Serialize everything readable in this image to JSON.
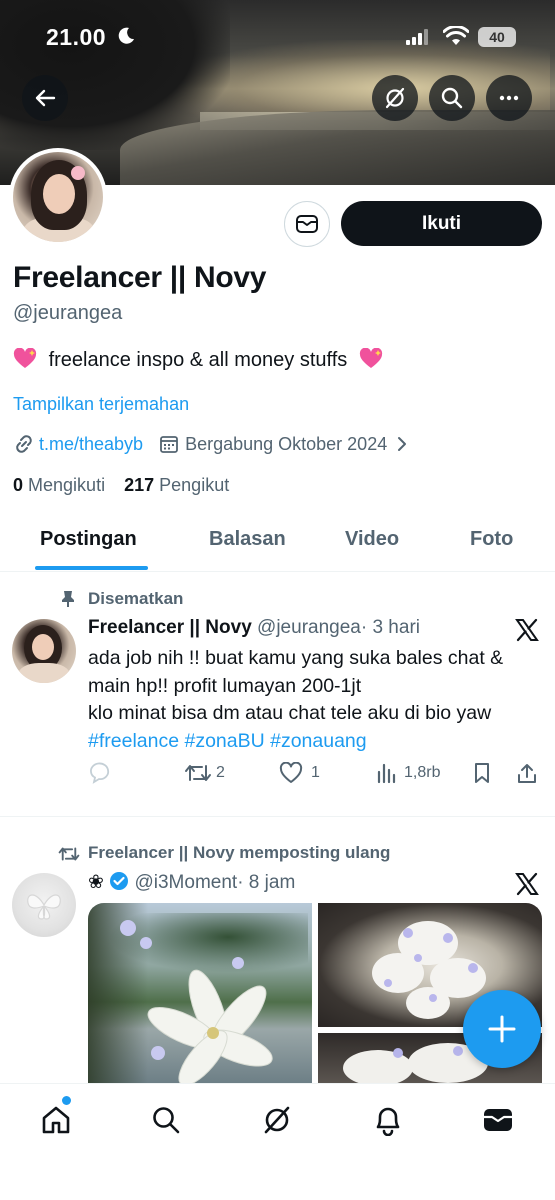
{
  "status_bar": {
    "time": "21.00",
    "battery": "40"
  },
  "profile": {
    "display_name": "Freelancer || Novy",
    "handle": "@jeurangea",
    "bio": "freelance inspo & all money stuffs",
    "translate_label": "Tampilkan terjemahan",
    "link": "t.me/theabyb",
    "joined": "Bergabung Oktober 2024",
    "following_count": "0",
    "following_label": "Mengikuti",
    "followers_count": "217",
    "followers_label": "Pengikut",
    "follow_button": "Ikuti"
  },
  "tabs": [
    "Postingan",
    "Balasan",
    "Video",
    "Foto"
  ],
  "pinned_post": {
    "pinned_label": "Disematkan",
    "author": "Freelancer || Novy",
    "handle": "@jeurangea",
    "time": "· 3 hari",
    "line1": "ada job nih !! buat kamu yang suka bales chat &",
    "line2": "main hp!! profit lumayan 200-1jt",
    "line3": "klo minat bisa dm atau chat tele aku di bio yaw",
    "hashtags": "#freelance #zonaBU #zonauang",
    "reposts": "2",
    "likes": "1",
    "views": "1,8rb"
  },
  "repost": {
    "label": "Freelancer || Novy memposting ulang",
    "author_symbol": "❀",
    "handle": "@i3Moment",
    "time": "· 8 jam"
  },
  "colors": {
    "accent": "#1d9bf0",
    "text": "#0f1419",
    "muted": "#536471"
  }
}
